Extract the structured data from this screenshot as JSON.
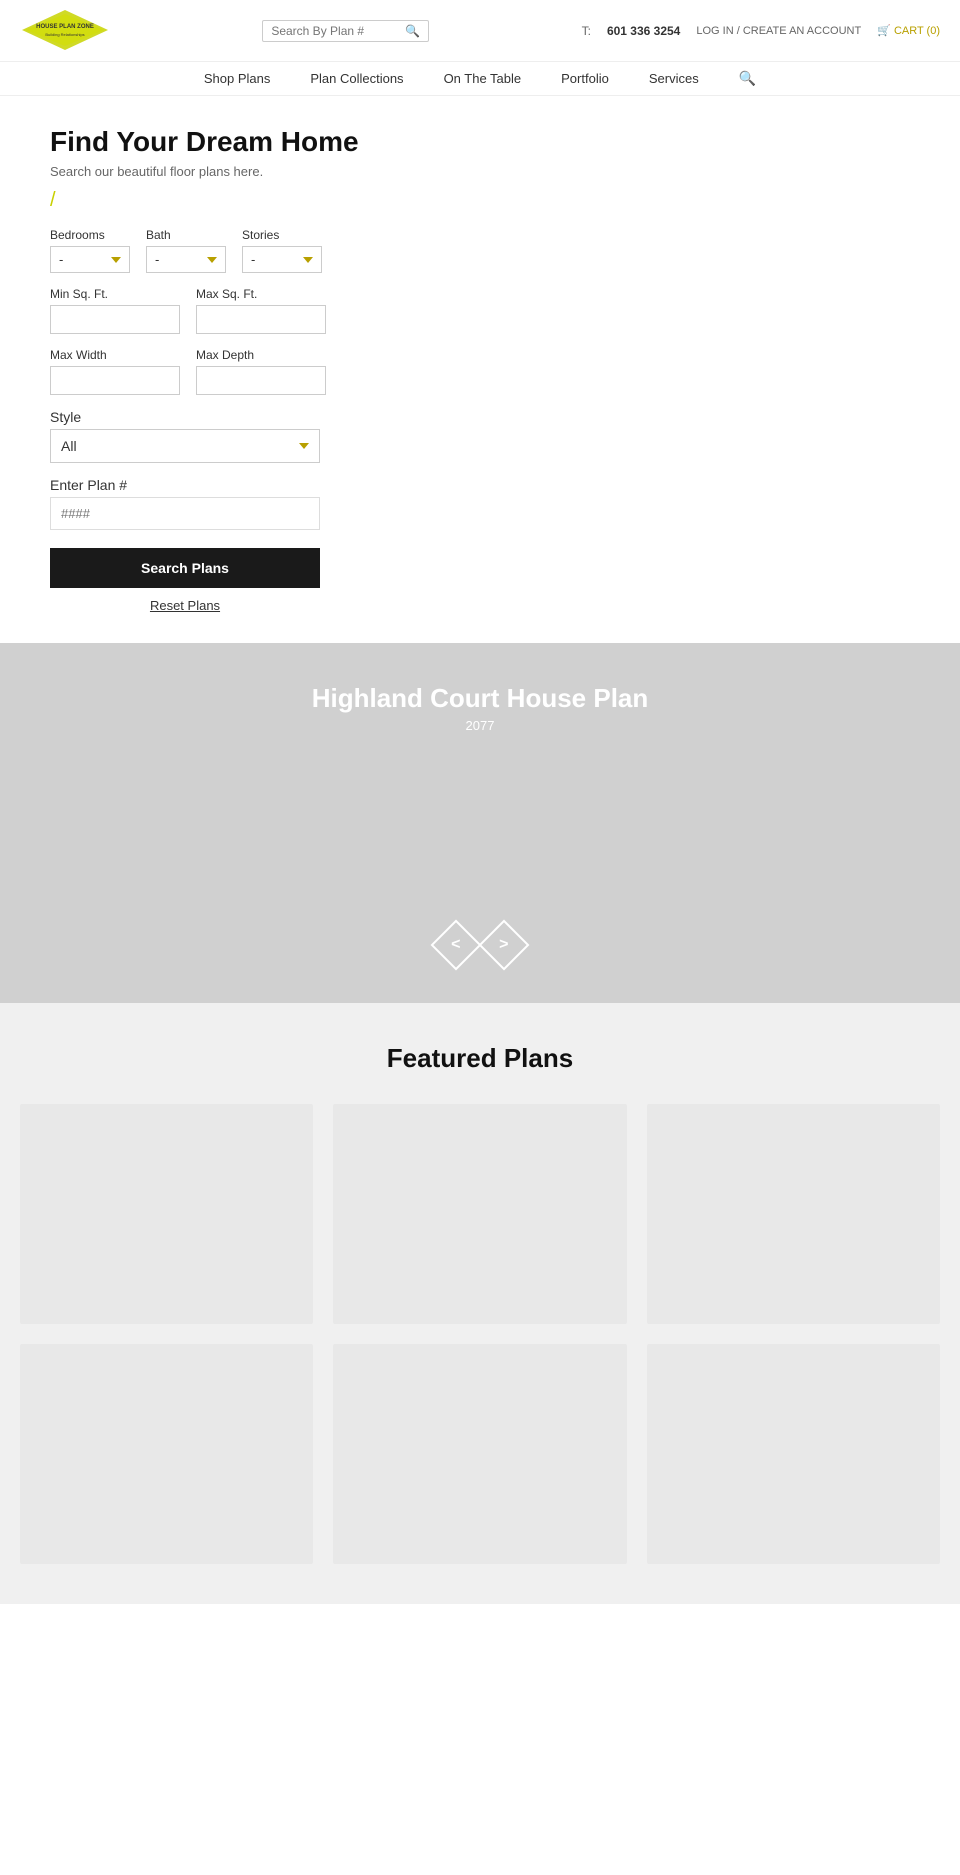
{
  "header": {
    "phone_label": "T:",
    "phone": "601 336 3254",
    "login_label": "LOG IN / CREATE AN ACCOUNT",
    "cart_label": "CART (0)",
    "search_placeholder": "Search By Plan #"
  },
  "nav": {
    "items": [
      {
        "label": "Shop Plans"
      },
      {
        "label": "Plan Collections"
      },
      {
        "label": "On The Table"
      },
      {
        "label": "Portfolio"
      },
      {
        "label": "Services"
      }
    ]
  },
  "hero_form": {
    "title": "Find Your Dream Home",
    "subtitle": "Search our beautiful floor plans here.",
    "bedrooms_label": "Bedrooms",
    "bath_label": "Bath",
    "stories_label": "Stories",
    "min_sqft_label": "Min Sq. Ft.",
    "max_sqft_label": "Max Sq. Ft.",
    "max_width_label": "Max Width",
    "max_depth_label": "Max Depth",
    "style_label": "Style",
    "plan_number_label": "Enter Plan #",
    "plan_number_placeholder": "####",
    "style_default": "All",
    "dropdown_default": "-",
    "search_btn": "Search Plans",
    "reset_btn": "Reset Plans"
  },
  "hero_banner": {
    "title": "Highland Court House Plan",
    "subtitle": "2077",
    "prev_label": "<",
    "next_label": ">"
  },
  "featured": {
    "title": "Featured Plans",
    "plans": [
      {},
      {},
      {},
      {},
      {},
      {}
    ]
  }
}
